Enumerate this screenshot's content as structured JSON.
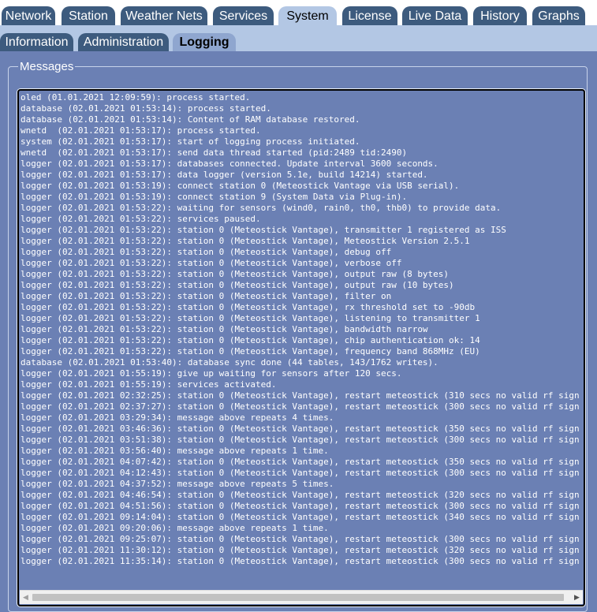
{
  "main_tabs": [
    {
      "label": "Network"
    },
    {
      "label": "Station"
    },
    {
      "label": "Weather Nets"
    },
    {
      "label": "Services"
    },
    {
      "label": "System",
      "active": true
    },
    {
      "label": "License"
    },
    {
      "label": "Live Data"
    },
    {
      "label": "History"
    },
    {
      "label": "Graphs"
    }
  ],
  "sub_tabs": [
    {
      "label": "Information"
    },
    {
      "label": "Administration"
    },
    {
      "label": "Logging",
      "active": true
    }
  ],
  "messages": {
    "legend": "Messages",
    "lines": [
      "oled (01.01.2021 12:09:59): process started.",
      "database (02.01.2021 01:53:14): process started.",
      "database (02.01.2021 01:53:14): Content of RAM database restored.",
      "wnetd  (02.01.2021 01:53:17): process started.",
      "system (02.01.2021 01:53:17): start of logging process initiated.",
      "wnetd  (02.01.2021 01:53:17): send data thread started (pid:2489 tid:2490)",
      "logger (02.01.2021 01:53:17): databases connected. Update interval 3600 seconds.",
      "logger (02.01.2021 01:53:17): data logger (version 5.1e, build 14214) started.",
      "logger (02.01.2021 01:53:19): connect station 0 (Meteostick Vantage via USB serial).",
      "logger (02.01.2021 01:53:19): connect station 9 (System Data via Plug-in).",
      "logger (02.01.2021 01:53:22): waiting for sensors (wind0, rain0, th0, thb0) to provide data.",
      "logger (02.01.2021 01:53:22): services paused.",
      "logger (02.01.2021 01:53:22): station 0 (Meteostick Vantage), transmitter 1 registered as ISS",
      "logger (02.01.2021 01:53:22): station 0 (Meteostick Vantage), Meteostick Version 2.5.1",
      "logger (02.01.2021 01:53:22): station 0 (Meteostick Vantage), debug off",
      "logger (02.01.2021 01:53:22): station 0 (Meteostick Vantage), verbose off",
      "logger (02.01.2021 01:53:22): station 0 (Meteostick Vantage), output raw (8 bytes)",
      "logger (02.01.2021 01:53:22): station 0 (Meteostick Vantage), output raw (10 bytes)",
      "logger (02.01.2021 01:53:22): station 0 (Meteostick Vantage), filter on",
      "logger (02.01.2021 01:53:22): station 0 (Meteostick Vantage), rx threshold set to -90db",
      "logger (02.01.2021 01:53:22): station 0 (Meteostick Vantage), listening to transmitter 1",
      "logger (02.01.2021 01:53:22): station 0 (Meteostick Vantage), bandwidth narrow",
      "logger (02.01.2021 01:53:22): station 0 (Meteostick Vantage), chip authentication ok: 14",
      "logger (02.01.2021 01:53:22): station 0 (Meteostick Vantage), frequency band 868MHz (EU)",
      "database (02.01.2021 01:53:40): database sync done (44 tables, 143/1762 writes).",
      "logger (02.01.2021 01:55:19): give up waiting for sensors after 120 secs.",
      "logger (02.01.2021 01:55:19): services activated.",
      "logger (02.01.2021 02:32:25): station 0 (Meteostick Vantage), restart meteostick (310 secs no valid rf sign",
      "logger (02.01.2021 02:37:27): station 0 (Meteostick Vantage), restart meteostick (300 secs no valid rf sign",
      "logger (02.01.2021 03:29:34): message above repeats 4 times.",
      "logger (02.01.2021 03:46:36): station 0 (Meteostick Vantage), restart meteostick (350 secs no valid rf sign",
      "logger (02.01.2021 03:51:38): station 0 (Meteostick Vantage), restart meteostick (300 secs no valid rf sign",
      "logger (02.01.2021 03:56:40): message above repeats 1 time.",
      "logger (02.01.2021 04:07:42): station 0 (Meteostick Vantage), restart meteostick (350 secs no valid rf sign",
      "logger (02.01.2021 04:12:43): station 0 (Meteostick Vantage), restart meteostick (300 secs no valid rf sign",
      "logger (02.01.2021 04:37:52): message above repeats 5 times.",
      "logger (02.01.2021 04:46:54): station 0 (Meteostick Vantage), restart meteostick (320 secs no valid rf sign",
      "logger (02.01.2021 04:51:56): station 0 (Meteostick Vantage), restart meteostick (300 secs no valid rf sign",
      "logger (02.01.2021 09:14:04): station 0 (Meteostick Vantage), restart meteostick (340 secs no valid rf sign",
      "logger (02.01.2021 09:20:06): message above repeats 1 time.",
      "logger (02.01.2021 09:25:07): station 0 (Meteostick Vantage), restart meteostick (300 secs no valid rf sign",
      "logger (02.01.2021 11:30:12): station 0 (Meteostick Vantage), restart meteostick (320 secs no valid rf sign",
      "logger (02.01.2021 11:35:14): station 0 (Meteostick Vantage), restart meteostick (300 secs no valid rf sign"
    ]
  },
  "scrollbar": {
    "left_arrow_icon": "arrow-left-icon",
    "right_arrow_icon": "arrow-right-icon"
  }
}
